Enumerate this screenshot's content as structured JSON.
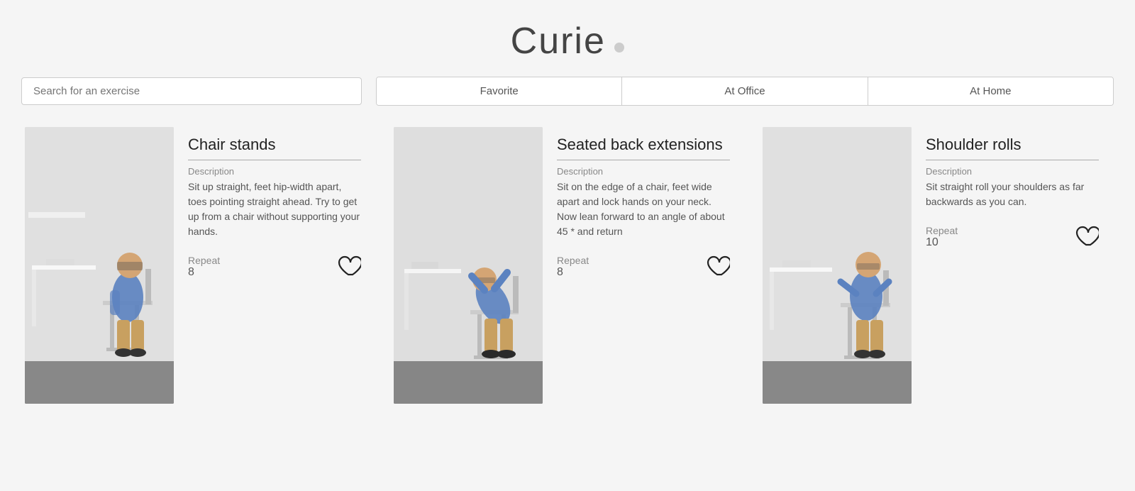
{
  "header": {
    "title": "Curie",
    "dot_visible": true
  },
  "search": {
    "placeholder": "Search for an exercise",
    "value": ""
  },
  "filter_tabs": [
    {
      "id": "favorite",
      "label": "Favorite"
    },
    {
      "id": "at-office",
      "label": "At Office"
    },
    {
      "id": "at-home",
      "label": "At Home"
    }
  ],
  "exercises": [
    {
      "id": "chair-stands",
      "name": "Chair stands",
      "description_label": "Description",
      "description": "Sit up straight, feet hip-width apart, toes pointing straight ahead. Try to get up from a chair without supporting your hands.",
      "repeat_label": "Repeat",
      "repeat_count": "8",
      "photo_class": "photo-1"
    },
    {
      "id": "seated-back-extensions",
      "name": "Seated back extensions",
      "description_label": "Description",
      "description": "Sit on the edge of a chair, feet wide apart and lock hands on your neck. Now lean forward to an angle of about 45 * and return",
      "repeat_label": "Repeat",
      "repeat_count": "8",
      "photo_class": "photo-2"
    },
    {
      "id": "shoulder-rolls",
      "name": "Shoulder rolls",
      "description_label": "Description",
      "description": "Sit straight roll your shoulders as far backwards as you can.",
      "repeat_label": "Repeat",
      "repeat_count": "10",
      "photo_class": "photo-3"
    }
  ]
}
